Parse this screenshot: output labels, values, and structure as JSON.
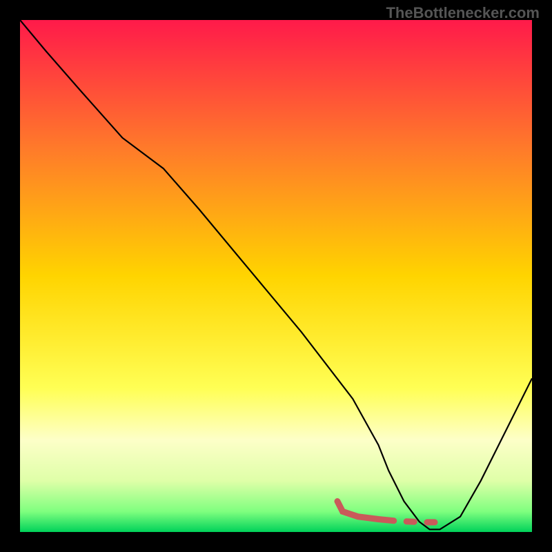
{
  "watermark": "TheBottlenecker.com",
  "chart_data": {
    "type": "line",
    "title": "",
    "xlabel": "",
    "ylabel": "",
    "xlim": [
      0,
      100
    ],
    "ylim": [
      0,
      100
    ],
    "gradient_stops": [
      {
        "offset": 0,
        "color": "#ff1a4a"
      },
      {
        "offset": 0.25,
        "color": "#ff7a2a"
      },
      {
        "offset": 0.5,
        "color": "#ffd400"
      },
      {
        "offset": 0.72,
        "color": "#ffff55"
      },
      {
        "offset": 0.82,
        "color": "#fdffc8"
      },
      {
        "offset": 0.9,
        "color": "#dfffa8"
      },
      {
        "offset": 0.96,
        "color": "#7fff7f"
      },
      {
        "offset": 1.0,
        "color": "#00d25a"
      }
    ],
    "series": [
      {
        "name": "bottleneck-curve",
        "stroke": "#000000",
        "stroke_width": 2.2,
        "x": [
          0,
          5,
          12,
          20,
          28,
          35,
          45,
          55,
          65,
          70,
          72,
          75,
          78,
          80,
          82,
          86,
          90,
          95,
          100
        ],
        "values": [
          100,
          94,
          86,
          77,
          71,
          63,
          51,
          39,
          26,
          17,
          12,
          6,
          2,
          0.5,
          0.5,
          3,
          10,
          20,
          30
        ]
      },
      {
        "name": "optimal-marker",
        "stroke": "#c95a5a",
        "stroke_width": 9,
        "linecap": "round",
        "x": [
          62,
          63,
          66,
          70,
          73,
          74.5,
          77.5,
          78.5,
          80,
          81
        ],
        "values": [
          6,
          4,
          3,
          2.5,
          2.2,
          2.1,
          2.0,
          1.9,
          1.9,
          1.9
        ],
        "dash": [
          0,
          0,
          0,
          0,
          0,
          0,
          0,
          0,
          0,
          0,
          0,
          6,
          0,
          0,
          0,
          6,
          0,
          0,
          0,
          0
        ]
      }
    ]
  }
}
